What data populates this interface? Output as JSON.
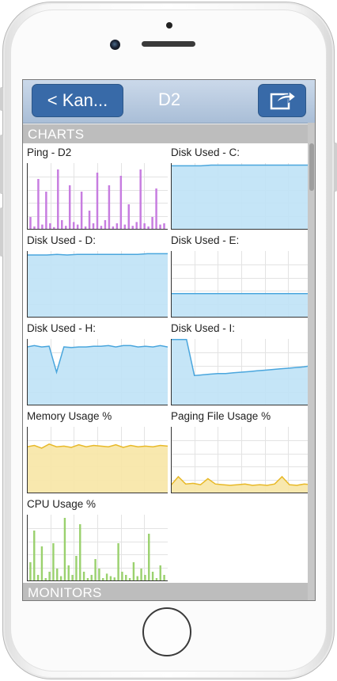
{
  "nav": {
    "back_label": "< Kan...",
    "title": "D2",
    "share_icon": "share-icon"
  },
  "sections": {
    "charts": "CHARTS",
    "monitors": "MONITORS"
  },
  "colors": {
    "nav_button": "#386aa8",
    "ping": "#c77de0",
    "disk": "#bfe2f6",
    "disk_line": "#4aa6dd",
    "memory": "#f7e6a5",
    "memory_line": "#e8b928",
    "cpu": "#9ad16e"
  },
  "charts": [
    {
      "title": "Ping - D2",
      "type": "bar",
      "color": "ping",
      "values": [
        20,
        5,
        80,
        8,
        60,
        10,
        4,
        95,
        15,
        6,
        70,
        12,
        8,
        60,
        5,
        30,
        10,
        90,
        6,
        15,
        70,
        5,
        10,
        85,
        8,
        40,
        6,
        12,
        95,
        10,
        5,
        20,
        65,
        8,
        10
      ]
    },
    {
      "title": "Disk Used - C:",
      "type": "area",
      "color": "disk",
      "values": [
        96,
        96,
        96,
        96,
        97,
        97,
        97,
        97,
        97,
        97,
        97,
        97,
        97,
        97,
        97
      ]
    },
    {
      "title": "Disk Used - D:",
      "type": "area",
      "color": "disk",
      "values": [
        94,
        94,
        94,
        95,
        94,
        95,
        95,
        95,
        95,
        95,
        95,
        95,
        96,
        96,
        96
      ]
    },
    {
      "title": "Disk Used - E:",
      "type": "area",
      "color": "disk",
      "values": [
        36,
        36,
        36,
        36,
        36,
        36,
        36,
        36,
        36,
        36,
        36,
        36,
        36,
        36,
        36
      ]
    },
    {
      "title": "Disk Used - H:",
      "type": "area",
      "color": "disk",
      "values": [
        88,
        90,
        88,
        89,
        50,
        88,
        87,
        88,
        88,
        89,
        89,
        90,
        88,
        90,
        90,
        88,
        89,
        88,
        90,
        88
      ]
    },
    {
      "title": "Disk Used - I:",
      "type": "area",
      "color": "disk",
      "values": [
        99,
        99,
        99,
        45,
        46,
        47,
        48,
        48,
        49,
        50,
        51,
        52,
        53,
        54,
        55,
        56,
        57,
        58,
        60
      ]
    },
    {
      "title": "Memory Usage %",
      "type": "area",
      "color": "memory",
      "values": [
        70,
        72,
        68,
        74,
        70,
        71,
        69,
        73,
        70,
        72,
        71,
        70,
        73,
        69,
        72,
        70,
        71,
        70,
        72,
        71
      ]
    },
    {
      "title": "Paging File Usage %",
      "type": "area",
      "color": "memory",
      "values": [
        12,
        25,
        14,
        15,
        13,
        22,
        14,
        13,
        12,
        13,
        14,
        12,
        13,
        12,
        14,
        25,
        13,
        12,
        14,
        13
      ]
    },
    {
      "title": "CPU Usage %",
      "type": "bar",
      "color": "cpu",
      "values": [
        30,
        80,
        10,
        55,
        5,
        15,
        60,
        20,
        8,
        100,
        25,
        10,
        40,
        90,
        15,
        5,
        10,
        35,
        20,
        5,
        12,
        8,
        6,
        60,
        15,
        10,
        5,
        30,
        8,
        20,
        10,
        75,
        15,
        5,
        25,
        10
      ]
    }
  ]
}
